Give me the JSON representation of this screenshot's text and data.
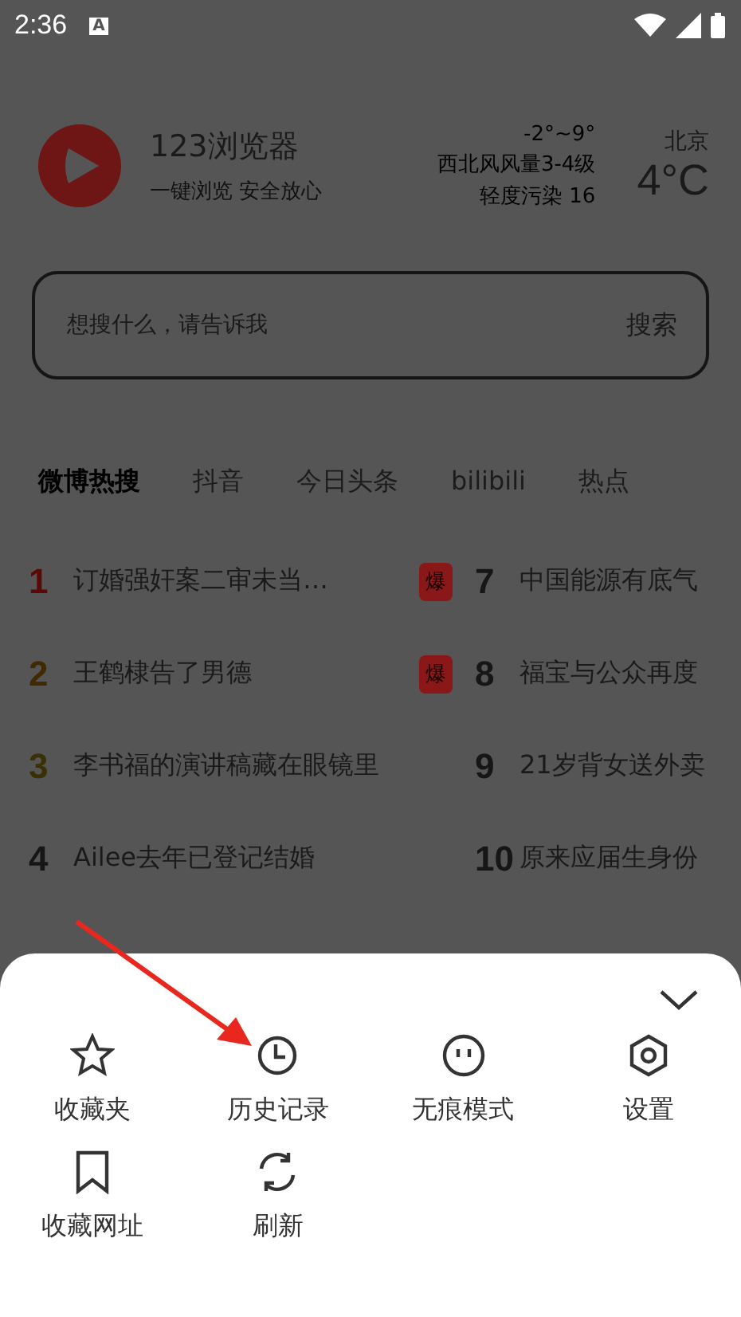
{
  "status_bar": {
    "time": "2:36",
    "notice": "A"
  },
  "header": {
    "app_name": "123浏览器",
    "slogan": "一键浏览 安全放心",
    "weather": {
      "range": "-2°~9°",
      "wind": "西北风风量3-4级",
      "air": "轻度污染 16",
      "city": "北京",
      "temperature": "4°C"
    }
  },
  "search": {
    "placeholder": "想搜什么，请告诉我",
    "button": "搜索"
  },
  "tabs": [
    {
      "label": "微博热搜",
      "selected": true
    },
    {
      "label": "抖音",
      "selected": false
    },
    {
      "label": "今日头条",
      "selected": false
    },
    {
      "label": "bilibili",
      "selected": false
    },
    {
      "label": "热点",
      "selected": false
    }
  ],
  "hot_list": [
    {
      "rank": "1",
      "title": "订婚强奸案二审未当…",
      "badge": "爆",
      "color": "#5a0808"
    },
    {
      "rank": "7",
      "title": "中国能源有底气",
      "color": "#161616"
    },
    {
      "rank": "2",
      "title": "王鹤棣告了男德",
      "badge": "爆",
      "color": "#402a02"
    },
    {
      "rank": "8",
      "title": "福宝与公众再度",
      "color": "#161616"
    },
    {
      "rank": "3",
      "title": "李书福的演讲稿藏在眼镜里",
      "color": "#3a2f05"
    },
    {
      "rank": "9",
      "title": "21岁背女送外卖",
      "color": "#161616"
    },
    {
      "rank": "4",
      "title": "Ailee去年已登记结婚",
      "color": "#161616"
    },
    {
      "rank": "10",
      "title": "原来应届生身份",
      "color": "#161616"
    }
  ],
  "menu": {
    "items": [
      {
        "label": "收藏夹",
        "kind": "star"
      },
      {
        "label": "历史记录",
        "kind": "clock"
      },
      {
        "label": "无痕模式",
        "kind": "face"
      },
      {
        "label": "设置",
        "kind": "settings"
      },
      {
        "label": "收藏网址",
        "kind": "bookmark"
      },
      {
        "label": "刷新",
        "kind": "refresh"
      }
    ]
  }
}
